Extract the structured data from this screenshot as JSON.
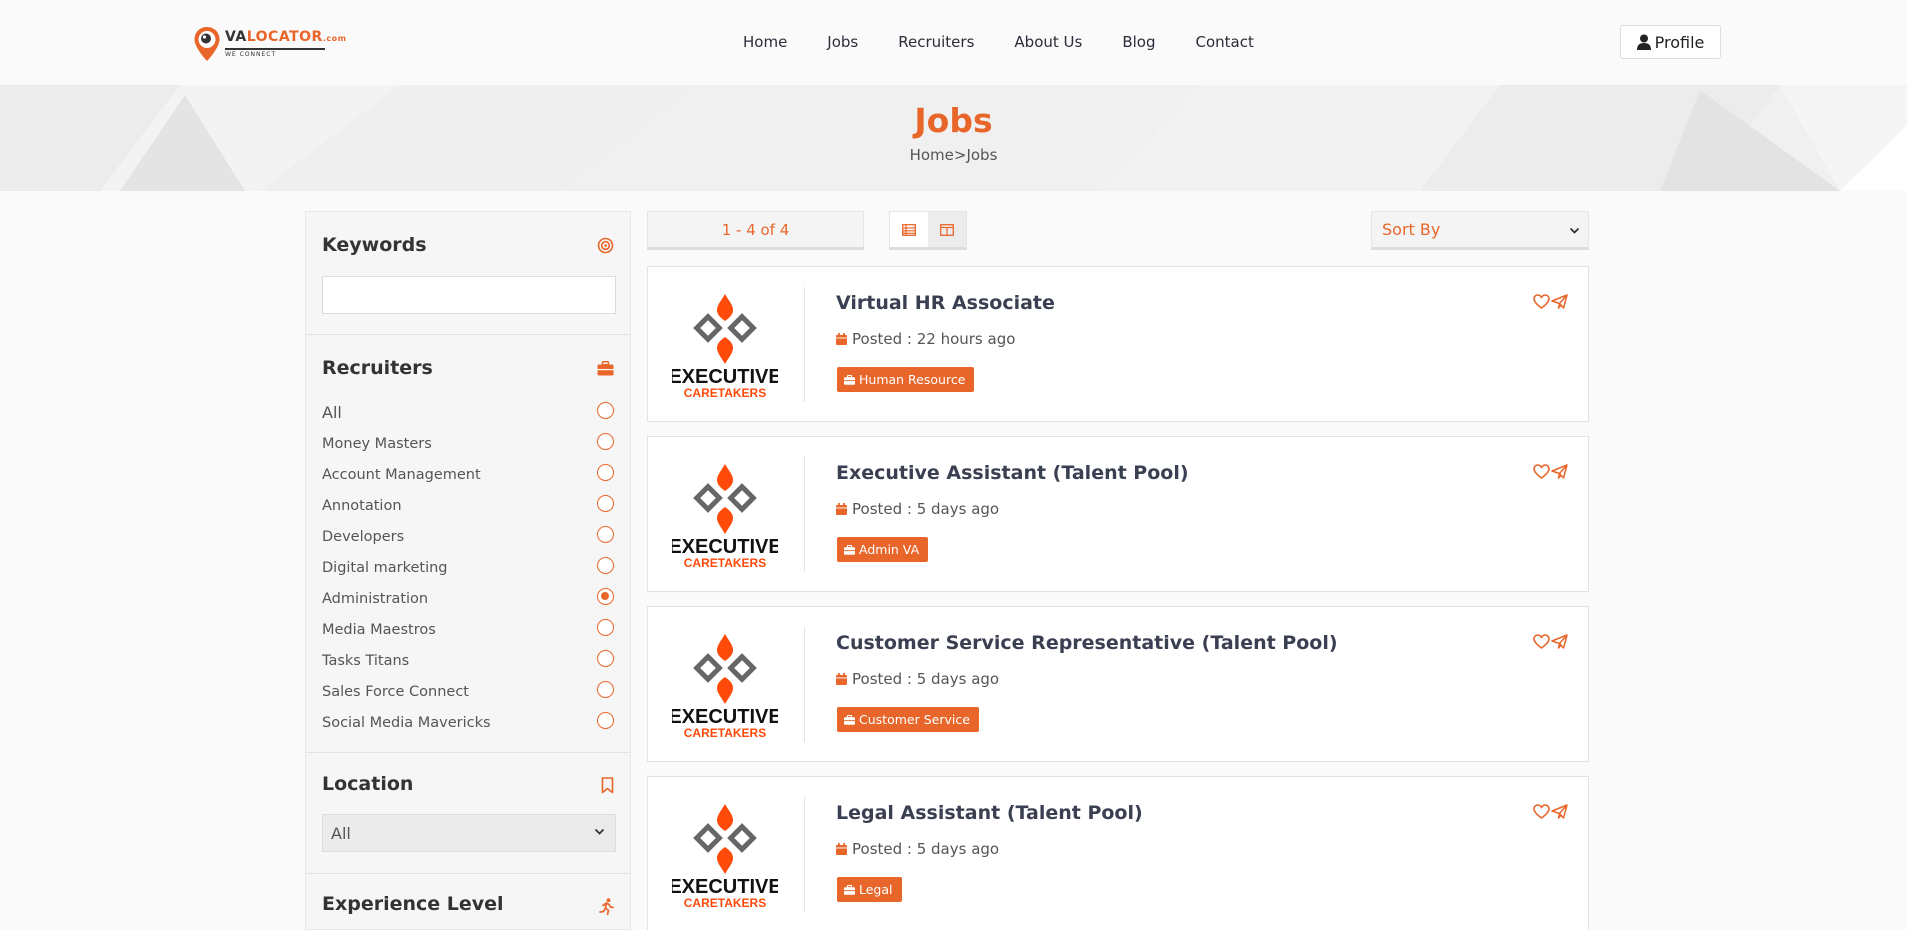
{
  "brand": {
    "logo_main_left": "VA",
    "logo_main_right": "LOCATOR",
    "logo_domain": ".com",
    "logo_sub": "WE CONNECT",
    "accent": "#e8662a"
  },
  "nav": {
    "items": [
      "Home",
      "Jobs",
      "Recruiters",
      "About Us",
      "Blog",
      "Contact"
    ],
    "profile_label": "Profile"
  },
  "hero": {
    "title": "Jobs",
    "breadcrumb": "Home>Jobs"
  },
  "sidebar": {
    "keywords": {
      "title": "Keywords",
      "value": "",
      "icon": "target-icon"
    },
    "recruiters": {
      "title": "Recruiters",
      "icon": "briefcase-icon",
      "items": [
        {
          "label": "All",
          "checked": false
        },
        {
          "label": "Money Masters",
          "checked": false
        },
        {
          "label": "Account Management",
          "checked": false
        },
        {
          "label": "Annotation",
          "checked": false
        },
        {
          "label": "Developers",
          "checked": false
        },
        {
          "label": "Digital marketing",
          "checked": false
        },
        {
          "label": "Administration",
          "checked": true
        },
        {
          "label": "Media Maestros",
          "checked": false
        },
        {
          "label": "Tasks Titans",
          "checked": false
        },
        {
          "label": "Sales Force Connect",
          "checked": false
        },
        {
          "label": "Social Media Mavericks",
          "checked": false
        }
      ]
    },
    "location": {
      "title": "Location",
      "selected": "All",
      "icon": "bookmark-icon"
    },
    "experience": {
      "title": "Experience Level",
      "icon": "running-icon"
    }
  },
  "toolbar": {
    "count": "1 - 4 of 4",
    "sort_selected": "Sort By"
  },
  "jobs": [
    {
      "title": "Virtual HR Associate",
      "posted": "Posted : 22 hours ago",
      "tag": "Human Resource",
      "company_line1": "EXECUTIVE",
      "company_line2": "CARETAKERS"
    },
    {
      "title": "Executive Assistant (Talent Pool)",
      "posted": "Posted : 5 days ago",
      "tag": "Admin VA",
      "company_line1": "EXECUTIVE",
      "company_line2": "CARETAKERS"
    },
    {
      "title": "Customer Service Representative (Talent Pool)",
      "posted": "Posted : 5 days ago",
      "tag": "Customer Service",
      "company_line1": "EXECUTIVE",
      "company_line2": "CARETAKERS"
    },
    {
      "title": "Legal Assistant (Talent Pool)",
      "posted": "Posted : 5 days ago",
      "tag": "Legal",
      "company_line1": "EXECUTIVE",
      "company_line2": "CARETAKERS"
    }
  ]
}
